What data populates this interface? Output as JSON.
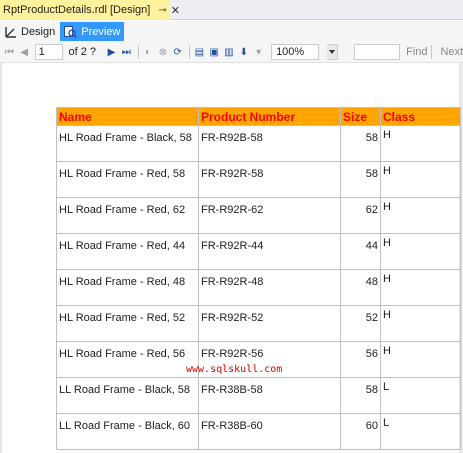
{
  "tab": {
    "title": "RptProductDetails.rdl [Design]",
    "pin_icon": "pin-icon",
    "close_icon": "close-icon"
  },
  "views": {
    "design_label": "Design",
    "preview_label": "Preview"
  },
  "toolbar": {
    "page_value": "1",
    "of_text": "of  2 ?",
    "zoom_value": "100%",
    "find_label": "Find",
    "next_label": "Next"
  },
  "report": {
    "headers": [
      "Name",
      "Product Number",
      "Size",
      "Class"
    ],
    "rows": [
      [
        "HL Road Frame - Black, 58",
        "FR-R92B-58",
        "58",
        "H"
      ],
      [
        "HL Road Frame - Red, 58",
        "FR-R92R-58",
        "58",
        "H"
      ],
      [
        "HL Road Frame - Red, 62",
        "FR-R92R-62",
        "62",
        "H"
      ],
      [
        "HL Road Frame - Red, 44",
        "FR-R92R-44",
        "44",
        "H"
      ],
      [
        "HL Road Frame - Red, 48",
        "FR-R92R-48",
        "48",
        "H"
      ],
      [
        "HL Road Frame - Red, 52",
        "FR-R92R-52",
        "52",
        "H"
      ],
      [
        "HL Road Frame - Red, 56",
        "FR-R92R-56",
        "56",
        "H"
      ],
      [
        "LL Road Frame - Black, 58",
        "FR-R38B-58",
        "58",
        "L"
      ],
      [
        "LL Road Frame - Black, 60",
        "FR-R38B-60",
        "60",
        "L"
      ]
    ]
  },
  "watermark": "www.sqlskull.com",
  "colors": {
    "tab_active": "#fff29d",
    "header_bg": "#ffa500",
    "header_text": "#ff0000",
    "preview_active": "#3399ff"
  }
}
